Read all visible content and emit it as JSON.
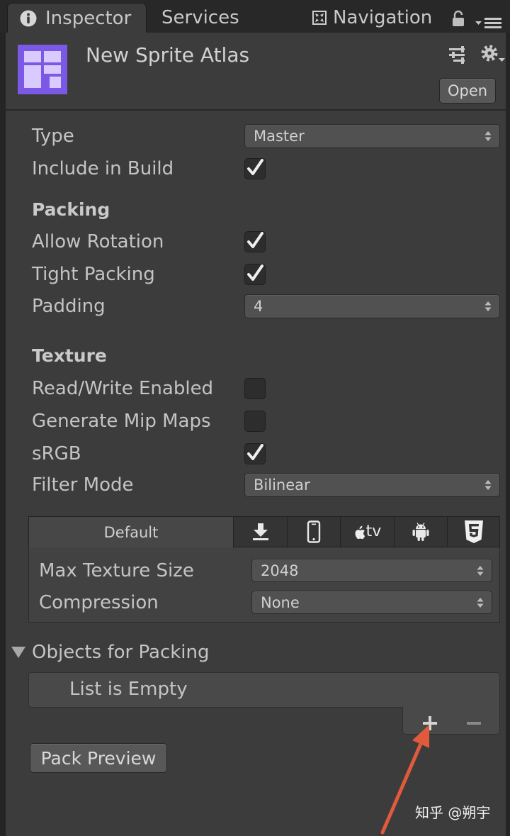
{
  "window": {
    "tabs": [
      {
        "label": "Inspector",
        "icon": "info-icon",
        "active": true
      },
      {
        "label": "Services",
        "active": false
      },
      {
        "label": "Navigation",
        "icon": "navigation-icon",
        "active": false
      }
    ],
    "toolbar_icons": [
      "lock-icon",
      "tab-menu-icon"
    ]
  },
  "header": {
    "asset_icon": "sprite-atlas-icon",
    "title": "New Sprite Atlas",
    "icons": [
      "preset-icon",
      "settings-gear-icon"
    ],
    "open_label": "Open"
  },
  "general": {
    "type": {
      "label": "Type",
      "value": "Master"
    },
    "include_in_build": {
      "label": "Include in Build",
      "checked": true
    }
  },
  "packing": {
    "heading": "Packing",
    "allow_rotation": {
      "label": "Allow Rotation",
      "checked": true
    },
    "tight_packing": {
      "label": "Tight Packing",
      "checked": true
    },
    "padding": {
      "label": "Padding",
      "value": "4"
    }
  },
  "texture": {
    "heading": "Texture",
    "read_write_enabled": {
      "label": "Read/Write Enabled",
      "checked": false
    },
    "generate_mip_maps": {
      "label": "Generate Mip Maps",
      "checked": false
    },
    "srgb": {
      "label": "sRGB",
      "checked": true
    },
    "filter_mode": {
      "label": "Filter Mode",
      "value": "Bilinear"
    }
  },
  "platform_settings": {
    "tabs": [
      {
        "label": "Default",
        "active": true
      },
      {
        "icon": "download-icon"
      },
      {
        "icon": "phone-icon"
      },
      {
        "icon": "apple-tv-icon",
        "logo_text": "tv"
      },
      {
        "icon": "android-icon"
      },
      {
        "icon": "html5-icon"
      }
    ],
    "max_texture_size": {
      "label": "Max Texture Size",
      "value": "2048"
    },
    "compression": {
      "label": "Compression",
      "value": "None"
    }
  },
  "objects_for_packing": {
    "label": "Objects for Packing",
    "expanded": true,
    "empty_text": "List is Empty",
    "footer_icons": [
      "plus-icon",
      "minus-icon"
    ]
  },
  "pack_preview_label": "Pack Preview",
  "watermark": "知乎 @朔宇",
  "colors": {
    "panel_background": "#3c3c3c",
    "label_text": "#c4c4c4",
    "asset_icon_purple": "#7c58e6",
    "annotation_arrow": "#e05a3b"
  }
}
